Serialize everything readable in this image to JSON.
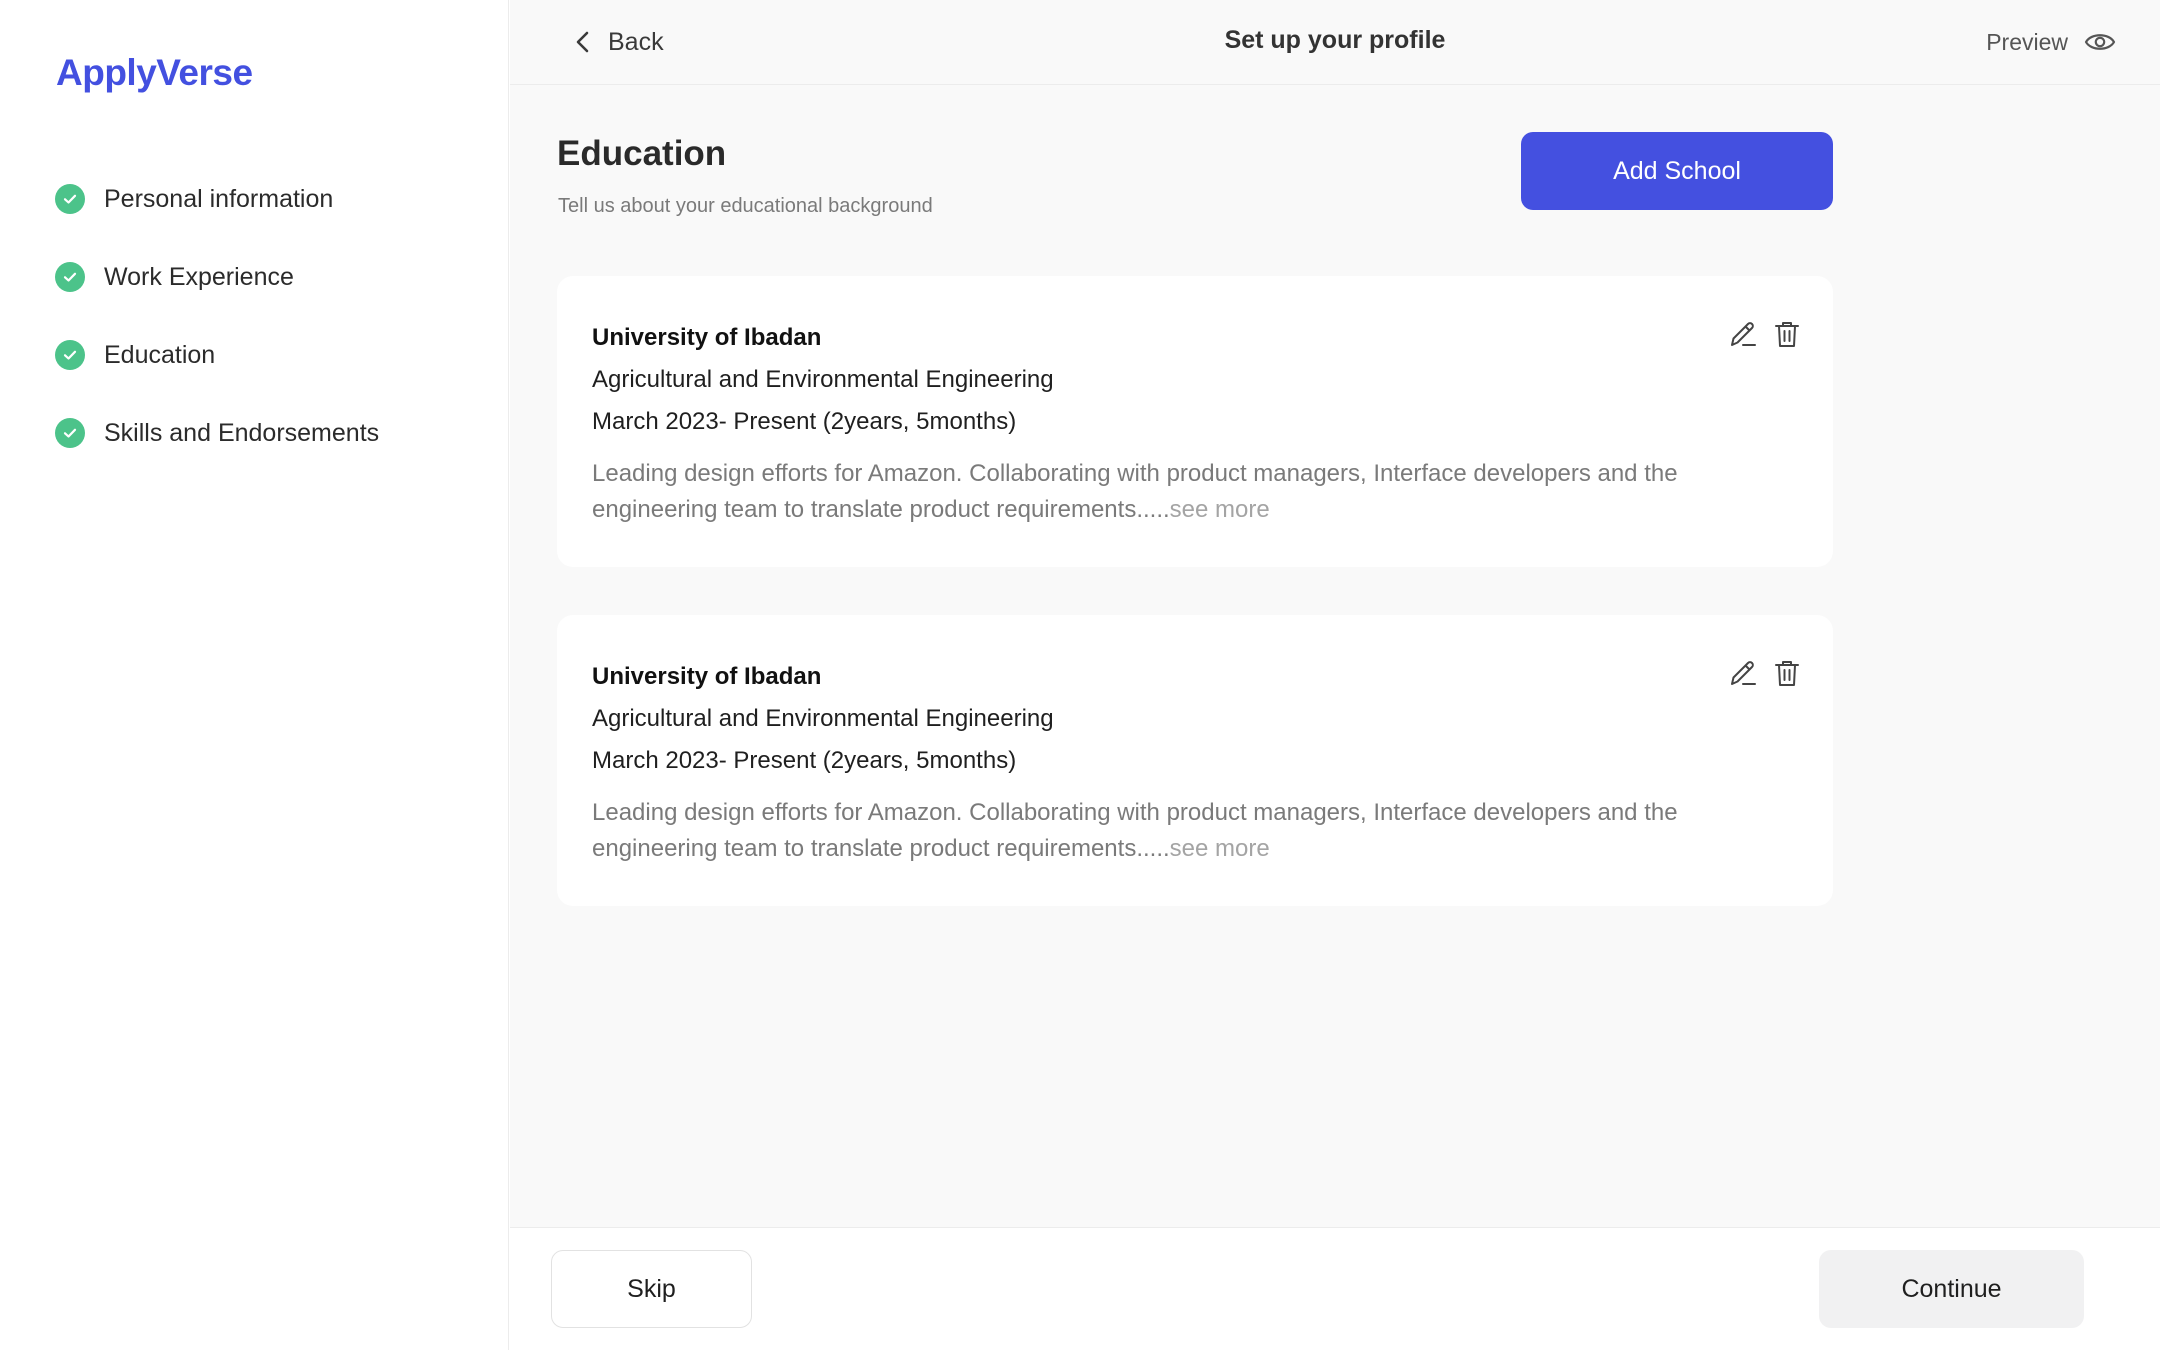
{
  "app": {
    "name": "ApplyVerse",
    "brand_color": "#4350e0"
  },
  "sidebar": {
    "steps": [
      {
        "label": "Personal information",
        "status": "complete",
        "icon": "check-circle-icon"
      },
      {
        "label": "Work Experience",
        "status": "complete",
        "icon": "check-circle-icon"
      },
      {
        "label": "Education",
        "status": "complete",
        "icon": "check-circle-icon"
      },
      {
        "label": "Skills and Endorsements",
        "status": "complete",
        "icon": "check-circle-icon"
      }
    ],
    "check_color": "#4cc38a"
  },
  "header": {
    "back_label": "Back",
    "title": "Set up your profile",
    "preview_label": "Preview"
  },
  "section": {
    "title": "Education",
    "subtitle": "Tell us about your educational background",
    "add_button_label": "Add School"
  },
  "education": [
    {
      "school": "University of Ibadan",
      "course": "Agricultural and Environmental Engineering",
      "dates": "March 2023- Present (2years, 5months)",
      "description": "Leading design efforts for Amazon. Collaborating with product managers, Interface developers and the engineering team to translate product requirements.....",
      "see_more": "see more"
    },
    {
      "school": "University of Ibadan",
      "course": "Agricultural and Environmental Engineering",
      "dates": "March 2023- Present (2years, 5months)",
      "description": "Leading design efforts for Amazon. Collaborating with product managers, Interface developers and the engineering team to translate product requirements.....",
      "see_more": "see more"
    }
  ],
  "footer": {
    "skip_label": "Skip",
    "continue_label": "Continue"
  }
}
